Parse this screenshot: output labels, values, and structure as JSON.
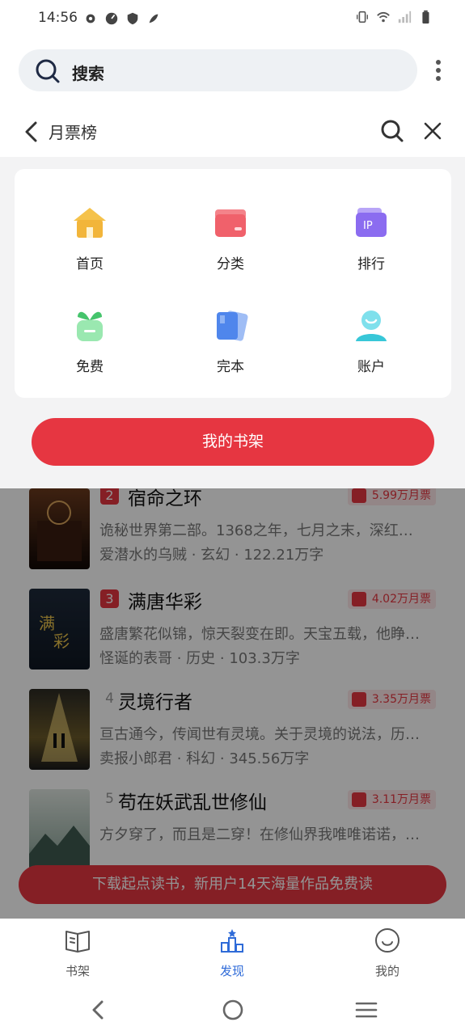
{
  "status_bar": {
    "time": "14:56",
    "icons": [
      "settings-icon",
      "vpn-icon",
      "shield-icon",
      "bird-icon"
    ],
    "right_icons": [
      "vibrate-icon",
      "wifi-icon",
      "signal-icon",
      "battery-icon"
    ]
  },
  "search": {
    "label": "搜索",
    "icon": "search-icon"
  },
  "header": {
    "title": "月票榜"
  },
  "menu": {
    "items": [
      {
        "label": "首页",
        "icon": "home-icon",
        "color": "#f2b53a"
      },
      {
        "label": "分类",
        "icon": "category-icon",
        "color": "#f0616b"
      },
      {
        "label": "排行",
        "icon": "ranking-icon",
        "color": "#8b6cf0"
      },
      {
        "label": "免费",
        "icon": "free-icon",
        "color": "#45c46c"
      },
      {
        "label": "完本",
        "icon": "completed-icon",
        "color": "#4f86ec"
      },
      {
        "label": "账户",
        "icon": "account-icon",
        "color": "#38c7d8"
      }
    ],
    "shelf_button": "我的书架"
  },
  "books": [
    {
      "rank": "2",
      "title": "宿命之环",
      "votes": "5.99万月票",
      "desc": "诡秘世界第二部。1368之年，七月之末，深红…",
      "meta": "爱潜水的乌贼 · 玄幻 · 122.21万字"
    },
    {
      "rank": "3",
      "title": "满唐华彩",
      "votes": "4.02万月票",
      "desc": "盛唐繁花似锦，惊天裂变在即。天宝五载，他睁…",
      "meta": "怪诞的表哥 · 历史 · 103.3万字"
    },
    {
      "rank": "4",
      "title": "灵境行者",
      "votes": "3.35万月票",
      "desc": "亘古通今，传闻世有灵境。关于灵境的说法，历…",
      "meta": "卖报小郎君 · 科幻 · 345.56万字"
    },
    {
      "rank": "5",
      "title": "苟在妖武乱世修仙",
      "votes": "3.11万月票",
      "desc": "方夕穿了，而且是二穿！在修仙界我唯唯诺诺，…",
      "meta": ""
    }
  ],
  "download_banner": "下载起点读书，新用户14天海量作品免费读",
  "tabs": [
    {
      "label": "书架",
      "icon": "book-icon"
    },
    {
      "label": "发现",
      "icon": "discover-icon"
    },
    {
      "label": "我的",
      "icon": "smile-icon"
    }
  ],
  "colors": {
    "accent": "#e63641",
    "active_tab": "#2f6bd8"
  }
}
